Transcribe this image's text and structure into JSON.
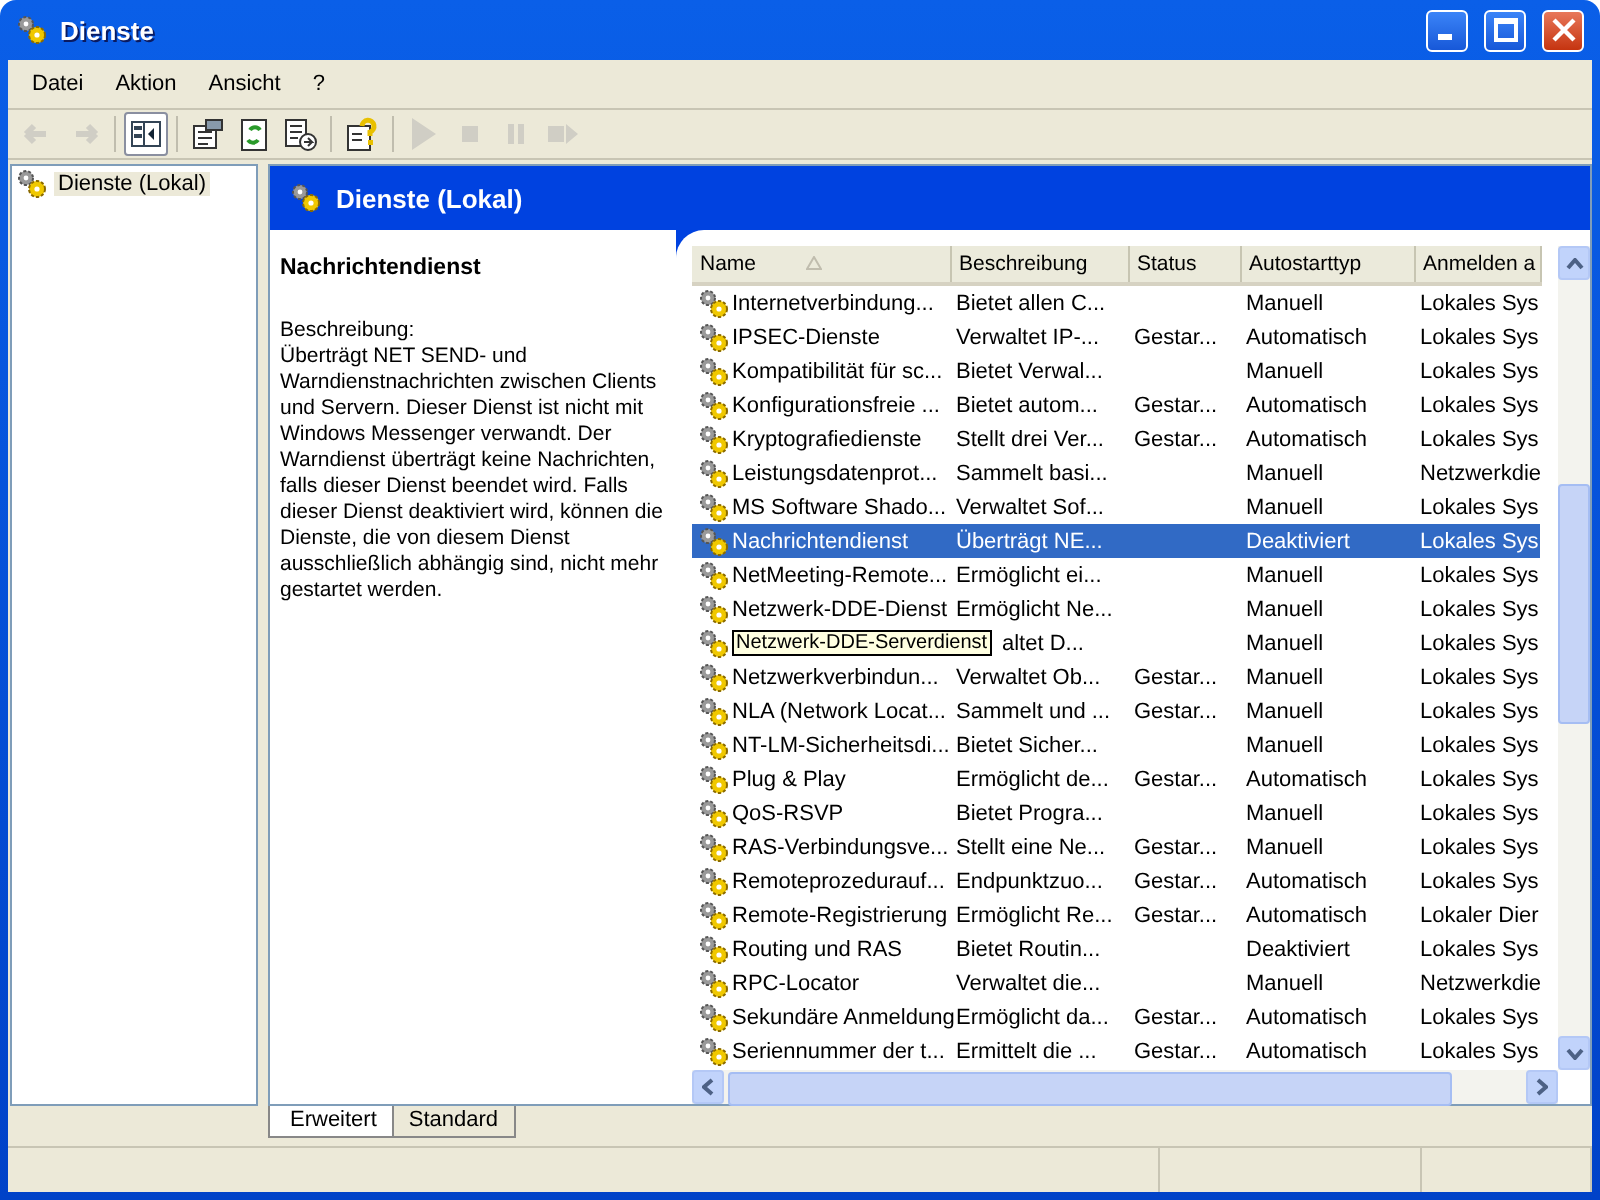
{
  "window": {
    "title": "Dienste"
  },
  "menu": [
    "Datei",
    "Aktion",
    "Ansicht",
    "?"
  ],
  "toolbar": [
    {
      "kind": "back",
      "disabled": true,
      "pressed": false
    },
    {
      "kind": "forward",
      "disabled": true,
      "pressed": false
    },
    {
      "kind": "sep"
    },
    {
      "kind": "tree",
      "disabled": false,
      "pressed": true
    },
    {
      "kind": "sep"
    },
    {
      "kind": "properties",
      "disabled": false,
      "pressed": false
    },
    {
      "kind": "refresh",
      "disabled": false,
      "pressed": false
    },
    {
      "kind": "export",
      "disabled": false,
      "pressed": false
    },
    {
      "kind": "sep"
    },
    {
      "kind": "help",
      "disabled": false,
      "pressed": false
    },
    {
      "kind": "sep"
    },
    {
      "kind": "play",
      "disabled": true,
      "pressed": false
    },
    {
      "kind": "stop",
      "disabled": true,
      "pressed": false
    },
    {
      "kind": "pause",
      "disabled": true,
      "pressed": false
    },
    {
      "kind": "restart",
      "disabled": true,
      "pressed": false
    }
  ],
  "tree": {
    "items": [
      {
        "label": "Dienste (Lokal)",
        "selected": true
      }
    ]
  },
  "header": {
    "title": "Dienste (Lokal)"
  },
  "details": {
    "title": "Nachrichtendienst",
    "label": "Beschreibung:",
    "text": "Überträgt NET SEND- und Warndienstnachrichten zwischen Clients und Servern. Dieser Dienst ist nicht mit Windows Messenger verwandt. Der Warndienst überträgt keine Nachrichten, falls dieser Dienst beendet wird. Falls dieser Dienst deaktiviert wird, können die Dienste, die von diesem Dienst ausschließlich abhängig sind, nicht mehr gestartet werden."
  },
  "table": {
    "columns": [
      "Name",
      "Beschreibung",
      "Status",
      "Autostarttyp",
      "Anmelden a"
    ],
    "rows": [
      {
        "name": "Internetverbindung...",
        "description": "Bietet allen C...",
        "status": "",
        "startup": "Manuell",
        "logon": "Lokales Sys",
        "selected": false
      },
      {
        "name": "IPSEC-Dienste",
        "description": "Verwaltet IP-...",
        "status": "Gestar...",
        "startup": "Automatisch",
        "logon": "Lokales Sys",
        "selected": false
      },
      {
        "name": "Kompatibilität für sc...",
        "description": "Bietet Verwal...",
        "status": "",
        "startup": "Manuell",
        "logon": "Lokales Sys",
        "selected": false
      },
      {
        "name": "Konfigurationsfreie ...",
        "description": "Bietet autom...",
        "status": "Gestar...",
        "startup": "Automatisch",
        "logon": "Lokales Sys",
        "selected": false
      },
      {
        "name": "Kryptografiedienste",
        "description": "Stellt drei Ver...",
        "status": "Gestar...",
        "startup": "Automatisch",
        "logon": "Lokales Sys",
        "selected": false
      },
      {
        "name": "Leistungsdatenprot...",
        "description": "Sammelt basi...",
        "status": "",
        "startup": "Manuell",
        "logon": "Netzwerkdie",
        "selected": false
      },
      {
        "name": "MS Software Shado...",
        "description": "Verwaltet Sof...",
        "status": "",
        "startup": "Manuell",
        "logon": "Lokales Sys",
        "selected": false
      },
      {
        "name": "Nachrichtendienst",
        "description": "Überträgt NE...",
        "status": "",
        "startup": "Deaktiviert",
        "logon": "Lokales Sys",
        "selected": true
      },
      {
        "name": "NetMeeting-Remote...",
        "description": "Ermöglicht ei...",
        "status": "",
        "startup": "Manuell",
        "logon": "Lokales Sys",
        "selected": false
      },
      {
        "name": "Netzwerk-DDE-Dienst",
        "description": "Ermöglicht Ne...",
        "status": "",
        "startup": "Manuell",
        "logon": "Lokales Sys",
        "selected": false
      },
      {
        "tooltip": "Netzwerk-DDE-Serverdienst",
        "description": "altet  D...",
        "status": "",
        "startup": "Manuell",
        "logon": "Lokales Sys",
        "selected": false
      },
      {
        "name": "Netzwerkverbindun...",
        "description": "Verwaltet Ob...",
        "status": "Gestar...",
        "startup": "Manuell",
        "logon": "Lokales Sys",
        "selected": false
      },
      {
        "name": "NLA (Network Locat...",
        "description": "Sammelt und ...",
        "status": "Gestar...",
        "startup": "Manuell",
        "logon": "Lokales Sys",
        "selected": false
      },
      {
        "name": "NT-LM-Sicherheitsdi...",
        "description": "Bietet Sicher...",
        "status": "",
        "startup": "Manuell",
        "logon": "Lokales Sys",
        "selected": false
      },
      {
        "name": "Plug & Play",
        "description": "Ermöglicht de...",
        "status": "Gestar...",
        "startup": "Automatisch",
        "logon": "Lokales Sys",
        "selected": false
      },
      {
        "name": "QoS-RSVP",
        "description": "Bietet Progra...",
        "status": "",
        "startup": "Manuell",
        "logon": "Lokales Sys",
        "selected": false
      },
      {
        "name": "RAS-Verbindungsve...",
        "description": "Stellt eine Ne...",
        "status": "Gestar...",
        "startup": "Manuell",
        "logon": "Lokales Sys",
        "selected": false
      },
      {
        "name": "Remoteprozedurauf...",
        "description": "Endpunktzuo...",
        "status": "Gestar...",
        "startup": "Automatisch",
        "logon": "Lokales Sys",
        "selected": false
      },
      {
        "name": "Remote-Registrierung",
        "description": "Ermöglicht Re...",
        "status": "Gestar...",
        "startup": "Automatisch",
        "logon": "Lokaler Dier",
        "selected": false
      },
      {
        "name": "Routing und RAS",
        "description": "Bietet Routin...",
        "status": "",
        "startup": "Deaktiviert",
        "logon": "Lokales Sys",
        "selected": false
      },
      {
        "name": "RPC-Locator",
        "description": "Verwaltet die...",
        "status": "",
        "startup": "Manuell",
        "logon": "Netzwerkdie",
        "selected": false
      },
      {
        "name": "Sekundäre Anmeldung",
        "description": "Ermöglicht da...",
        "status": "Gestar...",
        "startup": "Automatisch",
        "logon": "Lokales Sys",
        "selected": false
      },
      {
        "name": "Seriennummer der t...",
        "description": "Ermittelt die ...",
        "status": "Gestar...",
        "startup": "Automatisch",
        "logon": "Lokales Sys",
        "selected": false
      }
    ]
  },
  "tabs": [
    {
      "label": "Erweitert",
      "selected": true
    },
    {
      "label": "Standard",
      "selected": false
    }
  ]
}
